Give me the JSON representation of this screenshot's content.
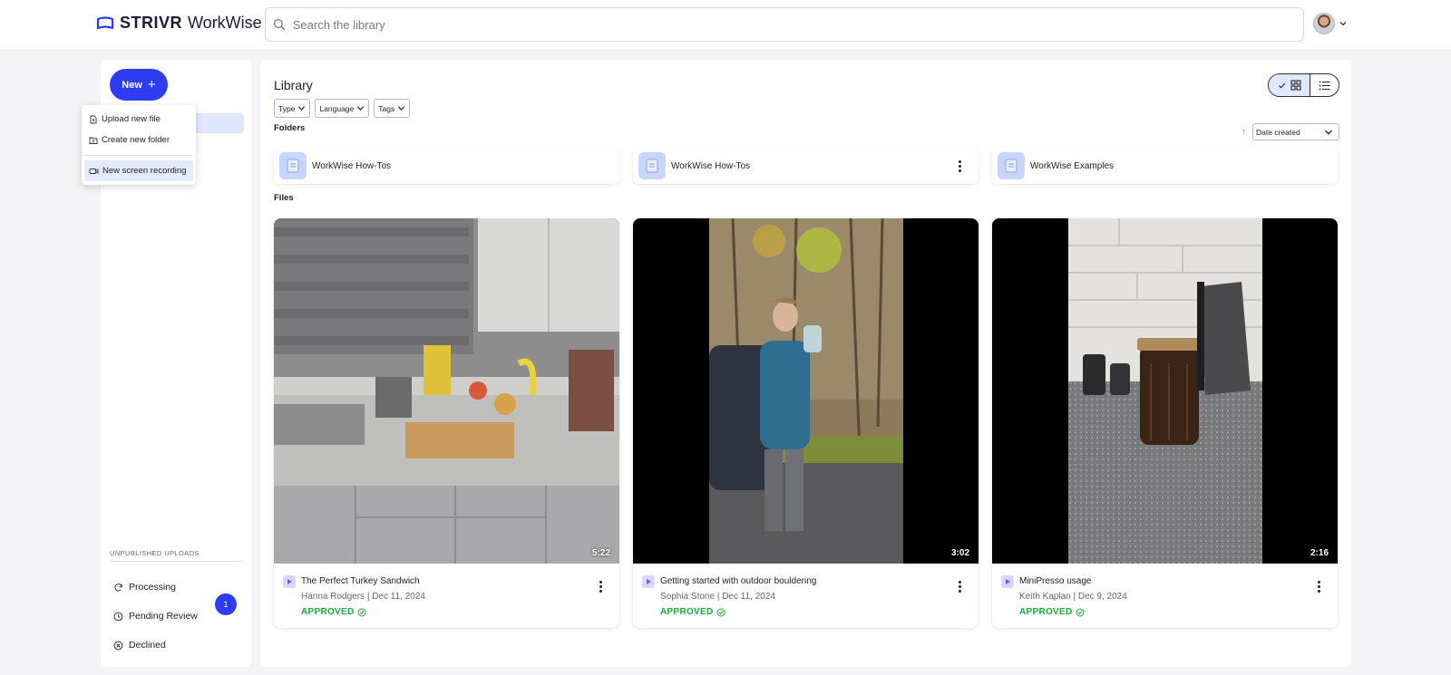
{
  "app": {
    "brand": "STRIVR",
    "product": "WorkWise"
  },
  "search": {
    "placeholder": "Search the library"
  },
  "sidebar": {
    "new_label": "New",
    "unpublished_label": "UNPUBLISHED UPLOADS",
    "items": [
      {
        "label": "Processing",
        "icon": "refresh-icon"
      },
      {
        "label": "Pending Review",
        "icon": "clock-icon",
        "badge": "1"
      },
      {
        "label": "Declined",
        "icon": "x-circle-icon"
      }
    ]
  },
  "new_menu": {
    "items": [
      {
        "label": "Upload new file",
        "icon": "file-upload-icon"
      },
      {
        "label": "Create new folder",
        "icon": "folder-plus-icon"
      },
      {
        "label": "New screen recording",
        "icon": "video-camera-icon"
      }
    ]
  },
  "library": {
    "title": "Library",
    "filters": [
      "Type",
      "Language",
      "Tags"
    ],
    "sort": {
      "label": "Date created",
      "direction": "ascending"
    },
    "view_mode": "grid",
    "folders_label": "Folders",
    "files_label": "Files",
    "folders": [
      {
        "name": "WorkWise How-Tos"
      },
      {
        "name": "WorkWise How-Tos"
      },
      {
        "name": "WorkWise Examples"
      }
    ],
    "files": [
      {
        "title": "The Perfect Turkey Sandwich",
        "meta": "Hanna Rodgers | Dec 11, 2024",
        "status": "APPROVED",
        "duration": "5:22"
      },
      {
        "title": "Getting started with outdoor bouldering",
        "meta": "Sophia Stone | Dec 11, 2024",
        "status": "APPROVED",
        "duration": "3:02"
      },
      {
        "title": "MiniPresso usage",
        "meta": "Keith Kaplan | Dec 9, 2024",
        "status": "APPROVED",
        "duration": "2:16"
      }
    ]
  },
  "colors": {
    "accent": "#2d3cf0",
    "approved": "#1fa83c",
    "highlight": "#dfe8ff"
  }
}
